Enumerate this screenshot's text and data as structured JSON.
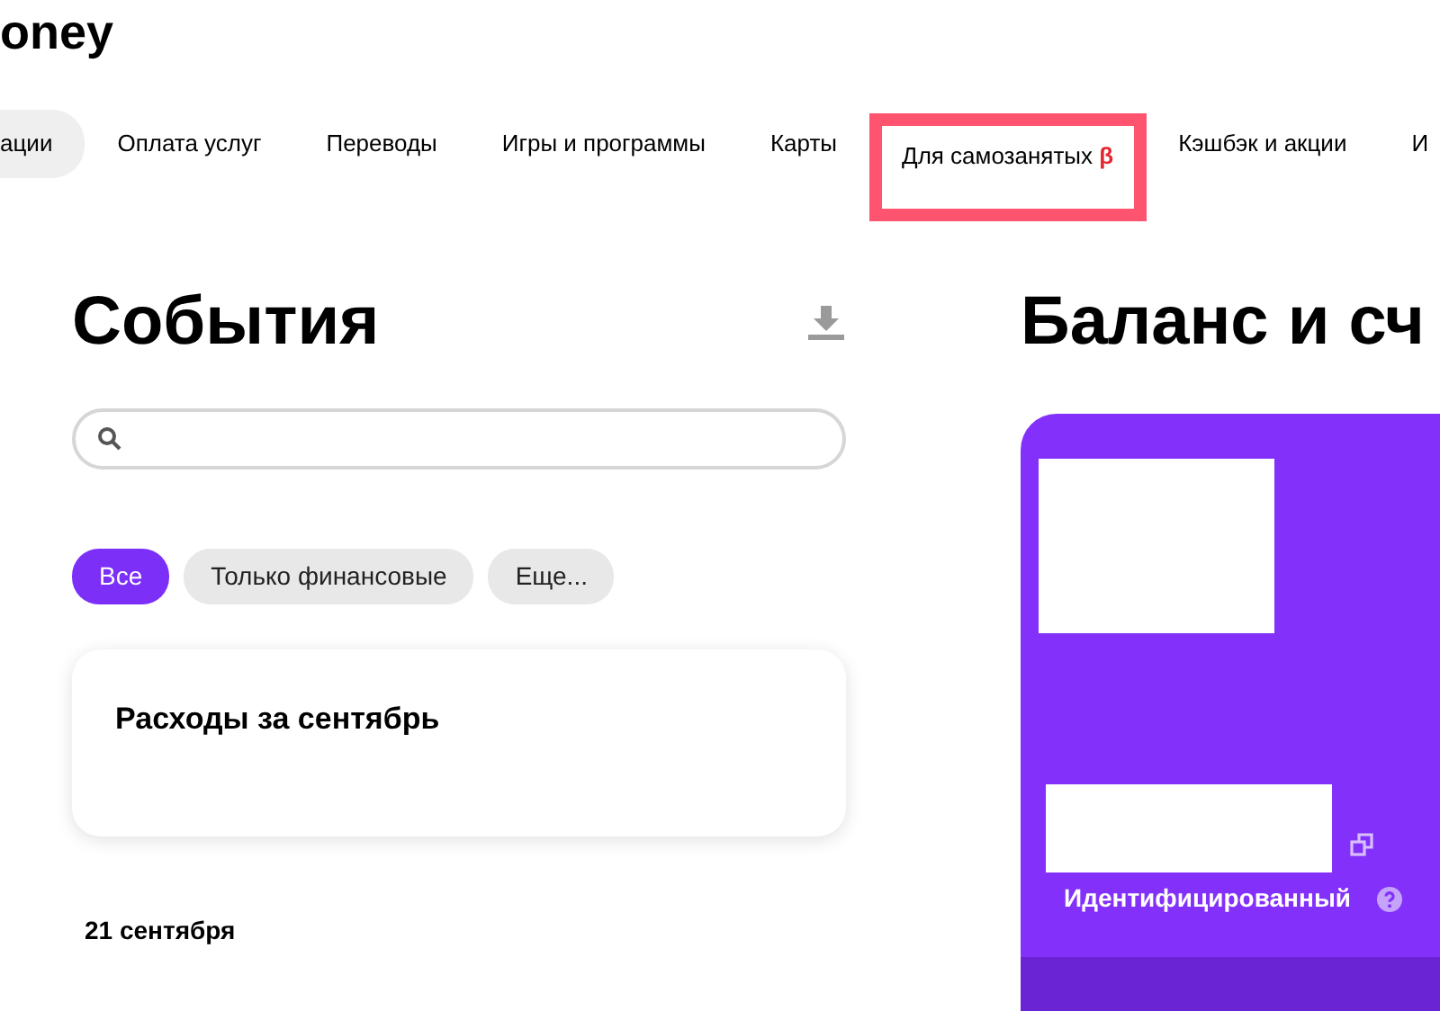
{
  "logo": {
    "text": "oney"
  },
  "nav": [
    {
      "label": "ации",
      "selected": true,
      "highlighted": false
    },
    {
      "label": "Оплата услуг",
      "selected": false,
      "highlighted": false
    },
    {
      "label": "Переводы",
      "selected": false,
      "highlighted": false
    },
    {
      "label": "Игры и программы",
      "selected": false,
      "highlighted": false
    },
    {
      "label": "Карты",
      "selected": false,
      "highlighted": false
    },
    {
      "label": "Для самозанятых",
      "badge": "β",
      "selected": false,
      "highlighted": true
    },
    {
      "label": "Кэшбэк и акции",
      "selected": false,
      "highlighted": false
    },
    {
      "label": "И",
      "selected": false,
      "highlighted": false
    }
  ],
  "events": {
    "title": "События",
    "filters": [
      {
        "label": "Все",
        "selected": true
      },
      {
        "label": "Только финансовые",
        "selected": false
      },
      {
        "label": "Еще...",
        "selected": false
      }
    ],
    "summary_card": {
      "title": "Расходы за сентябрь"
    },
    "date_heading": "21 сентября"
  },
  "balance": {
    "title": "Баланс и сч",
    "account_card": {
      "status": "Идентифицированный"
    }
  }
}
